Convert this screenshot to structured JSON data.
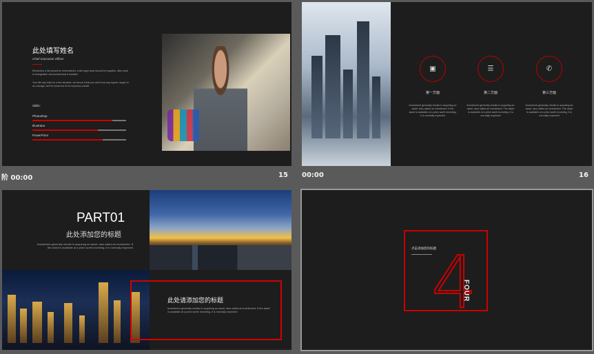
{
  "slides": [
    {
      "number": "15",
      "timer": "00:00",
      "name_title": "此处填写姓名",
      "role": "Chief Executive Officer",
      "paragraph1": "Remember a fall should be remembered, a fall forget what should be forgotten. Alter what is changeable, and accept what is mutable.",
      "paragraph2": "Your life only boils for a few decades, we favour it that you don't love any regrets, laugh on an courage, we'll fix tomorrow fix be surprises ourself.",
      "skills_label": "Skills:",
      "skills": [
        {
          "name": "Photoshop",
          "level": 0.85
        },
        {
          "name": "Illustrator",
          "level": 0.7
        },
        {
          "name": "PowerPoint",
          "level": 0.75
        }
      ]
    },
    {
      "number": "16",
      "timer": "00:00",
      "items": [
        {
          "title": "第一方面",
          "icon": "image-icon",
          "text": "Investment generally results in acquiring an asset, also called an investment. If the asset is available at a price worth investing, it is normally expected"
        },
        {
          "title": "第二方面",
          "icon": "sliders-icon",
          "text": "Investment generally results in acquiring an asset, also called an investment. The asset is available at a price worth investing, it is normally expected"
        },
        {
          "title": "第三方面",
          "icon": "phone-icon",
          "text": "Investment generally results in acquiring an asset, also called an investment. The asset is available at a price worth investing, it is normally expected"
        }
      ]
    },
    {
      "part": "PART01",
      "subtitle": "此处添加您的标题",
      "text": "Investment generally results in acquiring an asset, also called an investment. If the asset is available at a price worth investing, it is normally expected",
      "box_title": "此处请添加您的标题",
      "box_text": "Investment generally results in acquiring an asset, also called an investment. If the asset is available at a price worth investing, it is normally expected"
    },
    {
      "title": "点击添加您的标题",
      "number": "4",
      "label": "FOUR"
    }
  ],
  "timer_prefix": "阶",
  "colors": {
    "accent": "#cc0000",
    "slide_bg": "#1d1d1d",
    "canvas_bg": "#5a5a5a"
  }
}
